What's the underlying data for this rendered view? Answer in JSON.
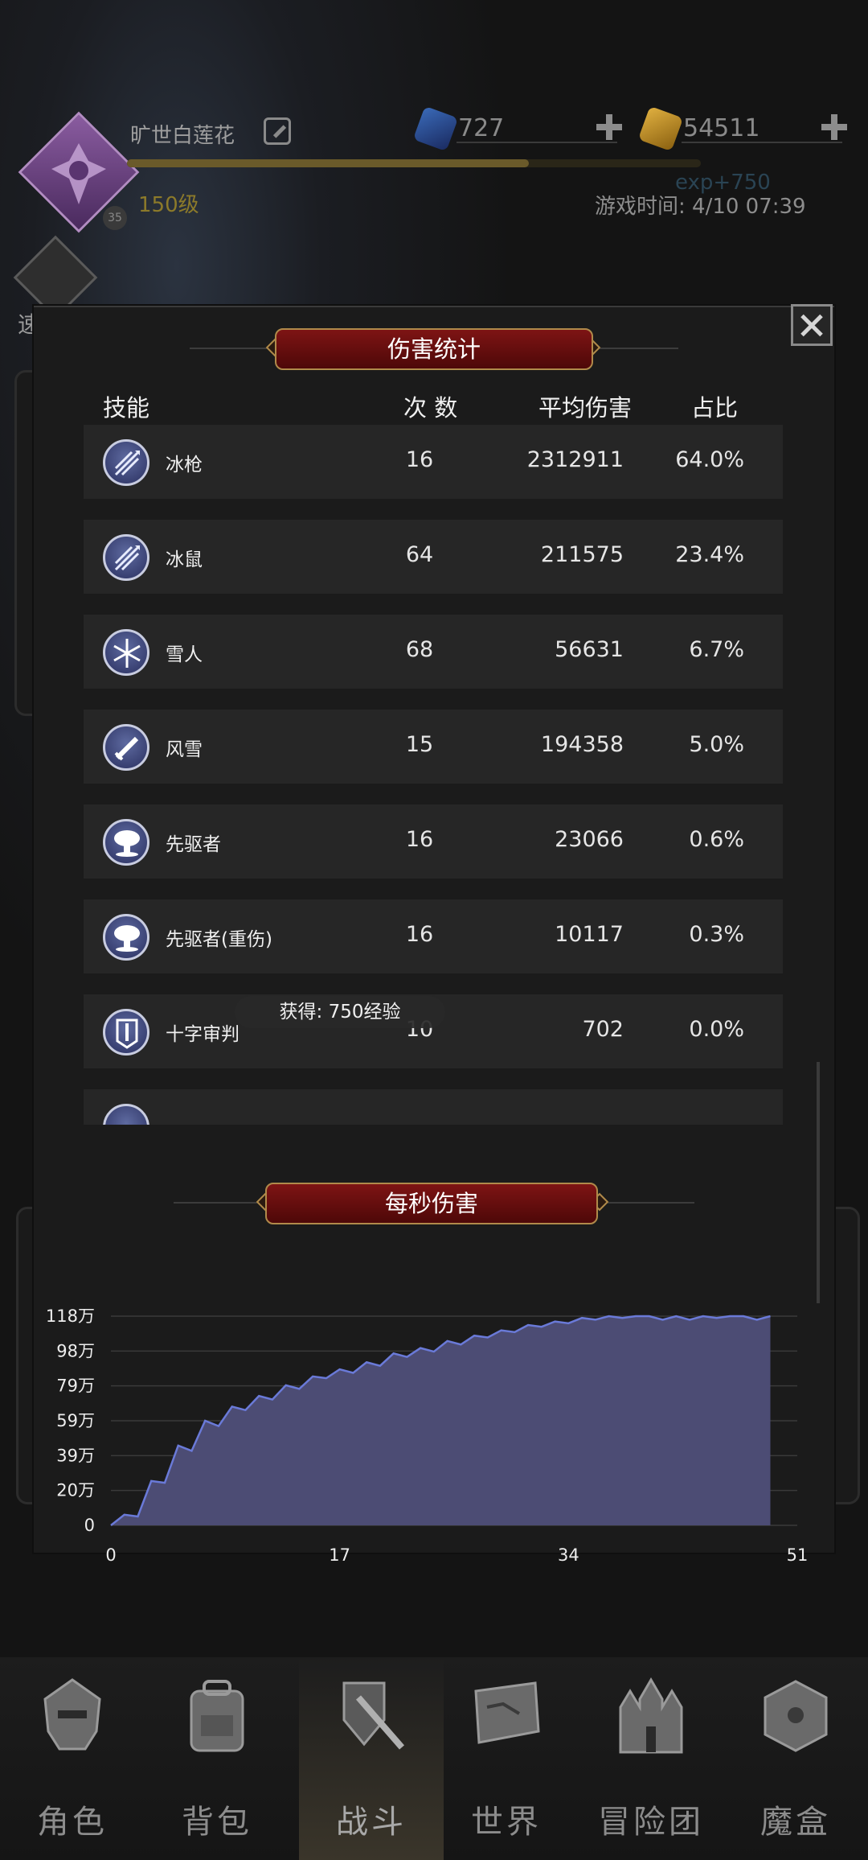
{
  "header": {
    "player_name": "旷世白莲花",
    "level": "150级",
    "avatar_badge": "35",
    "exp_gain": "exp+750",
    "exp_progress": 0.7,
    "game_time": "游戏时间: 4/10 07:39",
    "gems": "727",
    "gold": "54511",
    "speed_battle": "速战"
  },
  "dialog": {
    "title": "伤害统计",
    "columns": {
      "skill": "技能",
      "count": "次 数",
      "avg_damage": "平均伤害",
      "ratio": "占比"
    },
    "rows": [
      {
        "name": "冰枪",
        "count": "16",
        "avg": "2312911",
        "pct": "64.0%",
        "icon": "ice-spear-icon"
      },
      {
        "name": "冰鼠",
        "count": "64",
        "avg": "211575",
        "pct": "23.4%",
        "icon": "ice-spear-icon"
      },
      {
        "name": "雪人",
        "count": "68",
        "avg": "56631",
        "pct": "6.7%",
        "icon": "snowflake-icon"
      },
      {
        "name": "风雪",
        "count": "15",
        "avg": "194358",
        "pct": "5.0%",
        "icon": "sword-icon"
      },
      {
        "name": "先驱者",
        "count": "16",
        "avg": "23066",
        "pct": "0.6%",
        "icon": "mushroom-cloud-icon"
      },
      {
        "name": "先驱者(重伤)",
        "count": "16",
        "avg": "10117",
        "pct": "0.3%",
        "icon": "mushroom-cloud-icon"
      },
      {
        "name": "十字审判",
        "count": "10",
        "avg": "702",
        "pct": "0.0%",
        "icon": "banner-icon"
      }
    ],
    "toast": "获得: 750经验",
    "dps_title": "每秒伤害"
  },
  "chart_data": {
    "type": "area",
    "title": "每秒伤害",
    "xlabel": "",
    "ylabel": "",
    "xlim": [
      0,
      51
    ],
    "ylim": [
      0,
      1180000
    ],
    "x_ticks": [
      "0",
      "17",
      "34",
      "51"
    ],
    "y_ticks": [
      "0",
      "20万",
      "39万",
      "59万",
      "79万",
      "98万",
      "118万"
    ],
    "grid": true,
    "fill_color": "#4c4c74",
    "line_color": "#6a7ad8",
    "x": [
      0,
      1,
      2,
      3,
      4,
      5,
      6,
      7,
      8,
      9,
      10,
      11,
      12,
      13,
      14,
      15,
      16,
      17,
      18,
      19,
      20,
      21,
      22,
      23,
      24,
      25,
      26,
      27,
      28,
      29,
      30,
      31,
      32,
      33,
      34,
      35,
      36,
      37,
      38,
      39,
      40,
      41,
      42,
      43,
      44,
      45,
      46,
      47,
      48,
      49
    ],
    "y": [
      0,
      60000,
      50000,
      250000,
      240000,
      450000,
      420000,
      590000,
      560000,
      670000,
      650000,
      730000,
      710000,
      790000,
      770000,
      840000,
      830000,
      880000,
      860000,
      920000,
      900000,
      970000,
      950000,
      1000000,
      980000,
      1040000,
      1020000,
      1070000,
      1060000,
      1100000,
      1090000,
      1130000,
      1120000,
      1150000,
      1140000,
      1170000,
      1160000,
      1180000,
      1170000,
      1180000,
      1180000,
      1160000,
      1180000,
      1160000,
      1180000,
      1170000,
      1180000,
      1180000,
      1160000,
      1180000
    ]
  },
  "nav": {
    "items": [
      {
        "label": "角色",
        "icon": "helmet-icon"
      },
      {
        "label": "背包",
        "icon": "backpack-icon"
      },
      {
        "label": "战斗",
        "icon": "sword-shield-icon"
      },
      {
        "label": "世界",
        "icon": "map-scroll-icon"
      },
      {
        "label": "冒险团",
        "icon": "castle-icon"
      },
      {
        "label": "魔盒",
        "icon": "magic-cube-icon"
      }
    ],
    "active_index": 2
  },
  "colors": {
    "banner_red": "#7e1414",
    "banner_gold": "#b08a4a",
    "row_bg": "#262626",
    "chart_fill": "#4c4c74"
  }
}
